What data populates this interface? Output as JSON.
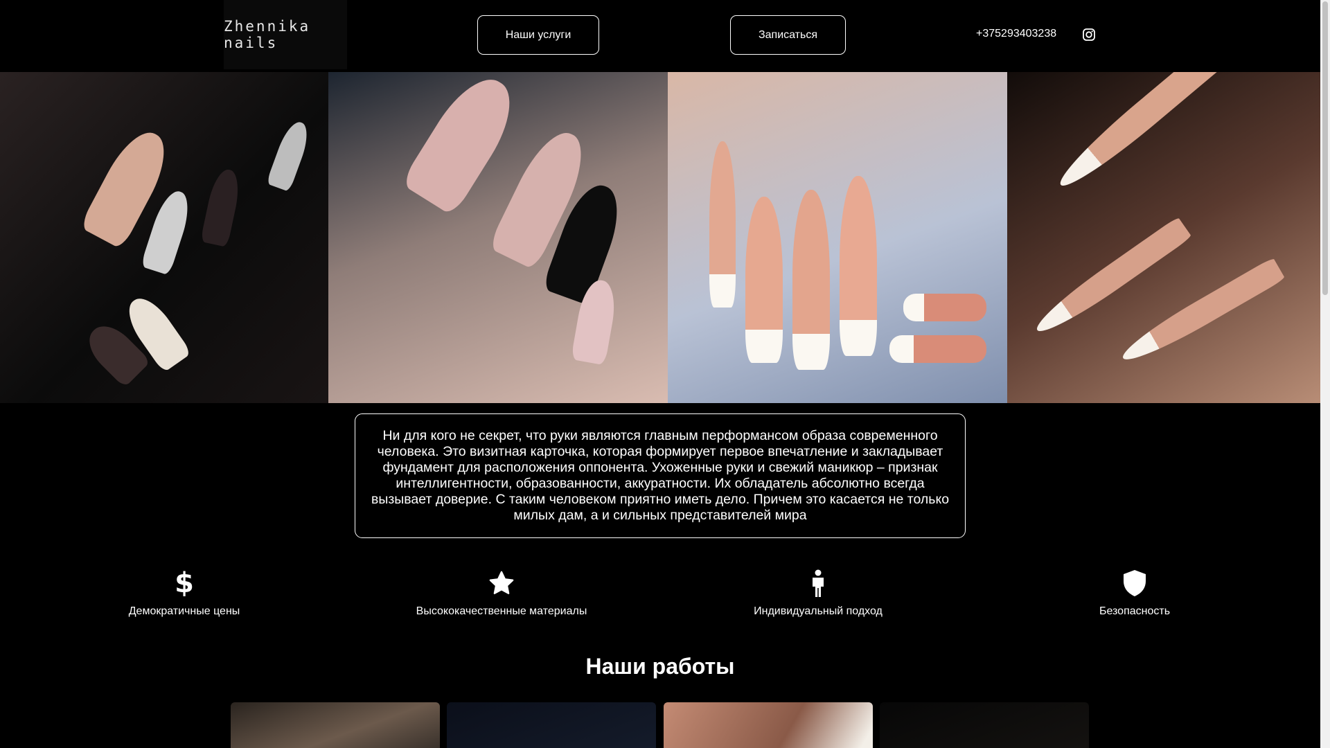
{
  "header": {
    "logo": "Zhennika  nails",
    "services_button": "Наши услуги",
    "book_button": "Записаться",
    "phone": "+375293403238",
    "social_icon": "instagram-icon"
  },
  "hero": {
    "images": [
      "nail-photo-black-art",
      "nail-photo-black-french",
      "nail-photo-white-french-square",
      "nail-photo-white-french-stiletto"
    ]
  },
  "about": {
    "text": "Ни для кого не секрет, что руки являются главным перформансом образа современного человека. Это визитная карточка, которая формирует первое впечатление и закладывает фундамент для расположения оппонента. Ухоженные руки и свежий маникюр – признак интеллигентности, образованности, аккуратности. Их обладатель абсолютно всегда вызывает доверие. С таким человеком приятно иметь дело. Причем это касается не только милых дам, а и сильных представителей мира"
  },
  "features": [
    {
      "icon": "dollar-icon",
      "label": "Демократичные цены"
    },
    {
      "icon": "star-icon",
      "label": "Высококачественные материалы"
    },
    {
      "icon": "person-icon",
      "label": "Индивидуальный подход"
    },
    {
      "icon": "shield-icon",
      "label": "Безопасность"
    }
  ],
  "works": {
    "title": "Наши работы"
  },
  "colors": {
    "background": "#000000",
    "text": "#ffffff",
    "border": "#ffffff"
  }
}
